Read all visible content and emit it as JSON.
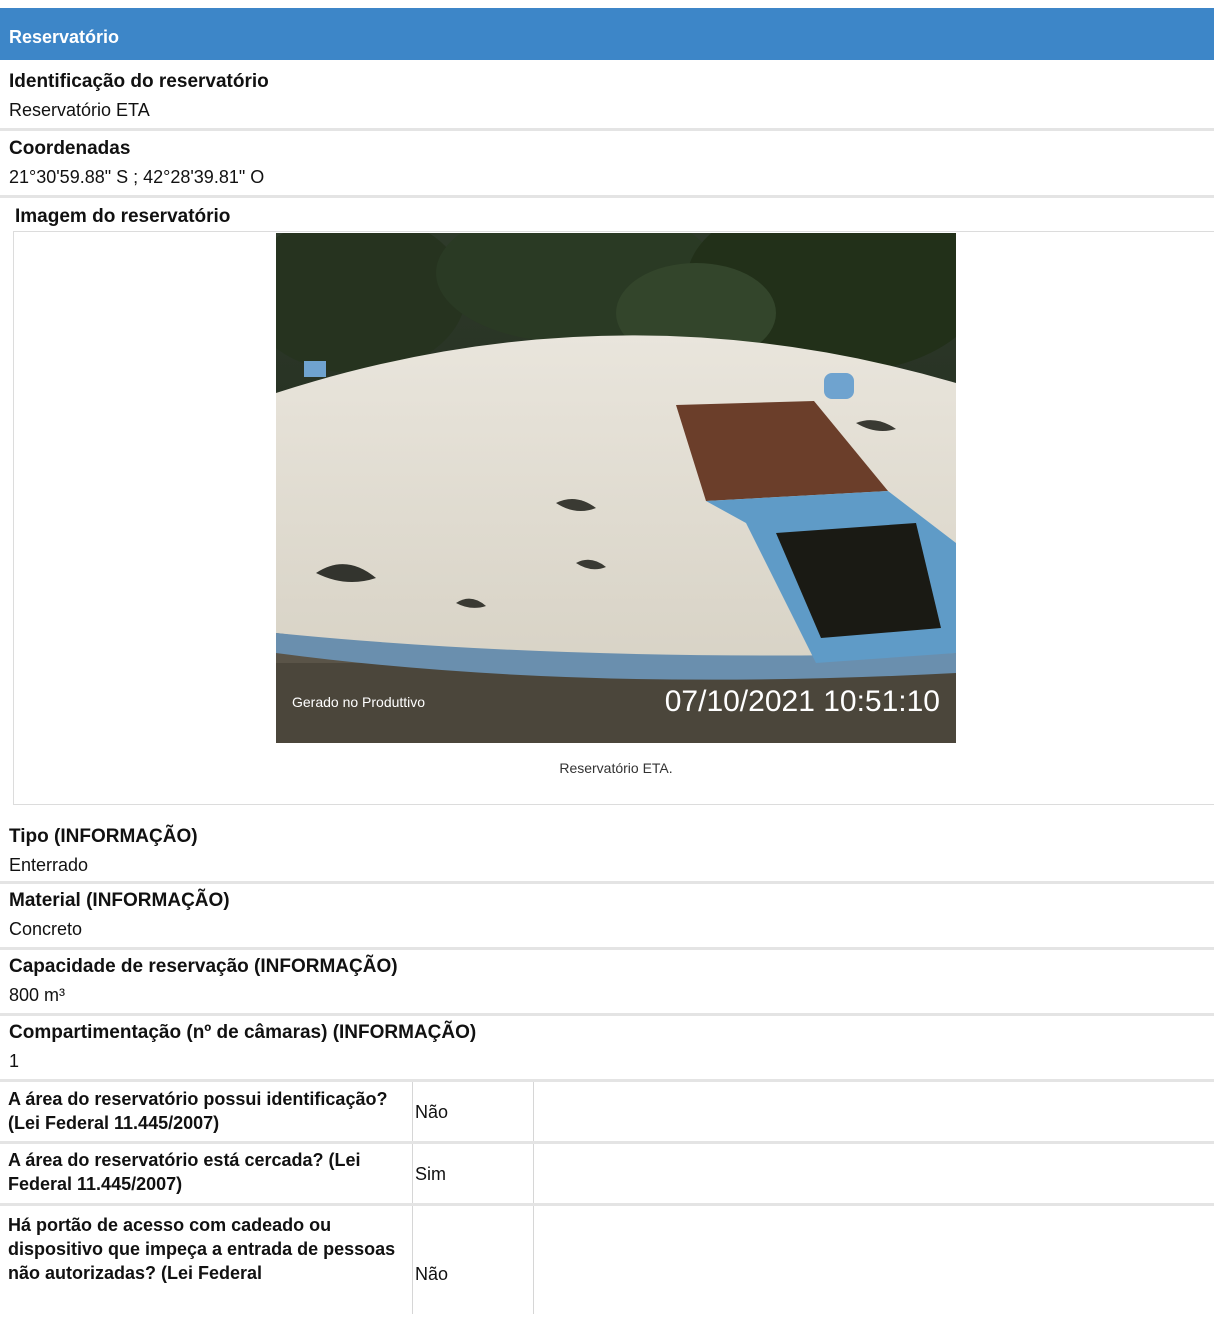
{
  "section_title": "Reservatório",
  "fields": [
    {
      "label": "Identificação do reservatório",
      "value": "Reservatório ETA"
    },
    {
      "label": "Coordenadas",
      "value": "21°30'59.88\" S ; 42°28'39.81\" O"
    }
  ],
  "image": {
    "label": "Imagem do reservatório",
    "watermark_left": "Gerado no Produttivo",
    "timestamp": "07/10/2021 10:51:10",
    "caption": "Reservatório ETA."
  },
  "info_fields": [
    {
      "label": "Tipo (INFORMAÇÃO)",
      "value": "Enterrado"
    },
    {
      "label": "Material (INFORMAÇÃO)",
      "value": "Concreto"
    },
    {
      "label": "Capacidade de reservação (INFORMAÇÃO)",
      "value": "800 m³"
    },
    {
      "label": "Compartimentação (nº de câmaras) (INFORMAÇÃO)",
      "value": "1"
    }
  ],
  "questions": [
    {
      "label": "A área do reservatório possui identificação? (Lei Federal 11.445/2007)",
      "answer": "Não"
    },
    {
      "label": "A área do reservatório está cercada? (Lei Federal 11.445/2007)",
      "answer": "Sim"
    },
    {
      "label": "Há portão de acesso com cadeado ou dispositivo que impeça a entrada de pessoas não autorizadas? (Lei Federal",
      "answer": "Não"
    }
  ]
}
